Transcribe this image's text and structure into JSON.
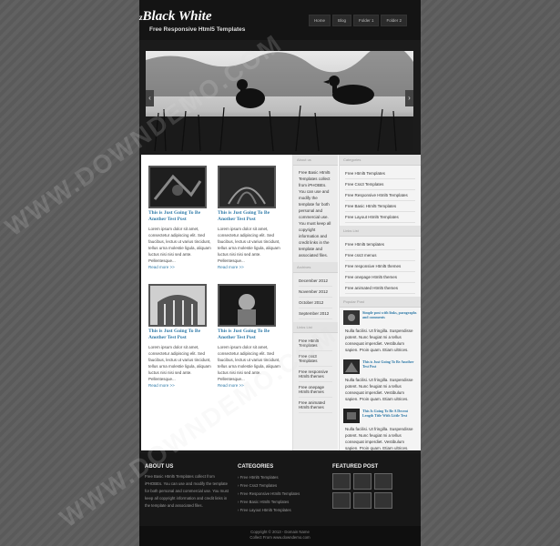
{
  "header": {
    "logo_prefix": "z",
    "logo": "Black White",
    "tagline": "Free Responsive Html5 Templates",
    "nav": [
      "Home",
      "Blog",
      "Folder 1",
      "Folder 2"
    ]
  },
  "slider": {
    "prev_icon": "‹",
    "next_icon": "›"
  },
  "posts": [
    {
      "title": "This is Just Going To Be Another Test Post",
      "excerpt": "Lorem ipsum dolor sit amet, consectetur adipiscing elit. Sed faucibus, lectus ut varius tincidunt, tellus urna molestie ligula, aliquam luctus nisi nisi sed ante. Pellentesque...",
      "more": "Read more >>"
    },
    {
      "title": "This is Just Going To Be Another Test Post",
      "excerpt": "Lorem ipsum dolor sit amet, consectetur adipiscing elit. Sed faucibus, lectus ut varius tincidunt, tellus urna molestie ligula, aliquam luctus nisi nisi sed ante. Pellentesque...",
      "more": "Read more >>"
    },
    {
      "title": "This is Just Going To Be Another Test Post",
      "excerpt": "Lorem ipsum dolor sit amet, consectetur adipiscing elit. Sed faucibus, lectus ut varius tincidunt, tellus urna molestie ligula, aliquam luctus nisi nisi sed ante. Pellentesque...",
      "more": "Read more >>"
    },
    {
      "title": "This is Just Going To Be Another Test Post",
      "excerpt": "Lorem ipsum dolor sit amet, consectetur adipiscing elit. Sed faucibus, lectus ut varius tincidunt, tellus urna molestie ligula, aliquam luctus nisi nisi sed ante. Pellentesque...",
      "more": "Read more >>"
    }
  ],
  "sidebar_about": {
    "title": "About us",
    "text": "Free Basic Html5 Templates collect from iPHOBEs. You can use and modify the template for both personal and commercial use. You must keep all copyright information and credit links in the template and associated files."
  },
  "archives": {
    "title": "Archives",
    "items": [
      "December 2012",
      "November 2012",
      "October 2012",
      "September 2012"
    ]
  },
  "links_left": {
    "title": "Links List",
    "items": [
      "Free Html5 Templates",
      "Free css3 Templates",
      "Free responsive Html5 themes",
      "Free onepage Html5 themes",
      "Free animated Html5 themes"
    ]
  },
  "categories": {
    "title": "Categories",
    "items": [
      "Free Html5 Templates",
      "Free Css3 Templates",
      "Free Responsive Html5 Templates",
      "Free Basic Html5 Templates",
      "Free Layout Html5 Templates"
    ]
  },
  "links_right": {
    "title": "Links List",
    "items": [
      "Free Html5 templates",
      "Free css3 menus",
      "Free responsive Html5 themes",
      "Free onepage Html5 themes",
      "Free animated Html5 themes"
    ]
  },
  "popular": {
    "title": "Popular Post",
    "items": [
      {
        "title": "Simple post with links, paragraphs and comments",
        "text": "Nulla facilisi. Ut fringilla. Suspendisse potent. Nunc feugiat mi a tellus consequat imperdiet. Vestibulum sapien. Proin quam. Etiam ultrices."
      },
      {
        "title": "This is Just Going To Be Another Test Post",
        "text": "Nulla facilisi. Ut fringilla. Suspendisse potent. Nunc feugiat mi a tellus consequat imperdiet. Vestibulum sapien. Proin quam. Etiam ultrices."
      },
      {
        "title": "This Is Going To Be A Decent Length Title With Little Text",
        "text": "Nulla facilisi. Ut fringilla. Suspendisse potent. Nunc feugiat mi a tellus consequat imperdiet. Vestibulum sapien. Proin quam. Etiam ultrices."
      }
    ]
  },
  "footer": {
    "about_title": "ABOUT US",
    "about_text": "Free Basic Html5 Templates collect from iPHOBEs. You can use and modify the template for both personal and commercial use. You must keep all copyright information and credit links in the template and associated files.",
    "categories_title": "CATEGORIES",
    "categories": [
      "Free Html5 Templates",
      "Free Css3 Templates",
      "Free Responsive Html5 Templates",
      "Free Basic Html5 Templates",
      "Free Layout Html5 Templates"
    ],
    "featured_title": "FEATURED POST",
    "copyright": "Copyright © 2013 - Domain Name",
    "credit": "Collect From www.downdemo.com"
  },
  "watermark": "WWW.DOWNDEMO.COM"
}
